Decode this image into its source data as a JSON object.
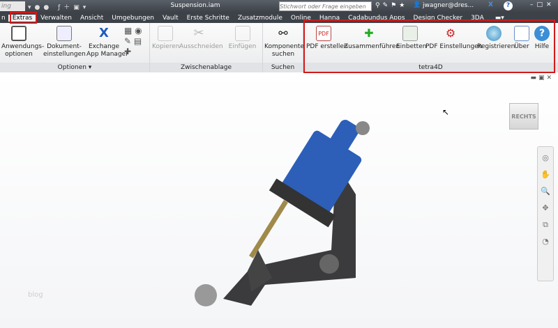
{
  "titlebar": {
    "quick_access_text": "ing",
    "title": "Suspension.iam",
    "search_placeholder": "Stichwort oder Frage eingeben",
    "user": "jwagner@dres...",
    "help": "?"
  },
  "menu": {
    "tabs": [
      "n",
      "Extras",
      "Verwalten",
      "Ansicht",
      "Umgebungen",
      "Vault",
      "Erste Schritte",
      "Zusatzmodule",
      "Online",
      "Hanna",
      "Cadabundus Apps",
      "Design Checker",
      "3DA"
    ],
    "active": "Extras"
  },
  "ribbon": {
    "optionen": {
      "label": "Optionen ▾",
      "buttons": [
        "Anwendungs-\noptionen",
        "Dokument-\neinstellungen",
        "Exchange\nApp Manager"
      ]
    },
    "zwischenablage": {
      "label": "Zwischenablage",
      "buttons": [
        "Kopieren",
        "Ausschneiden",
        "Einfügen"
      ]
    },
    "suchen": {
      "label": "Suchen",
      "buttons": [
        "Komponente\nsuchen"
      ]
    },
    "tetra4d": {
      "label": "tetra4D",
      "buttons": [
        "PDF erstellen",
        "Zusammenführen",
        "Einbetten",
        "PDF Einstellungen",
        "Registrieren",
        "Über",
        "Hilfe"
      ]
    }
  },
  "viewport": {
    "viewcube_label": "RECHTS",
    "watermark": "blog"
  },
  "colors": {
    "highlight": "#d11a1a",
    "accent": "#1e5bbf"
  }
}
